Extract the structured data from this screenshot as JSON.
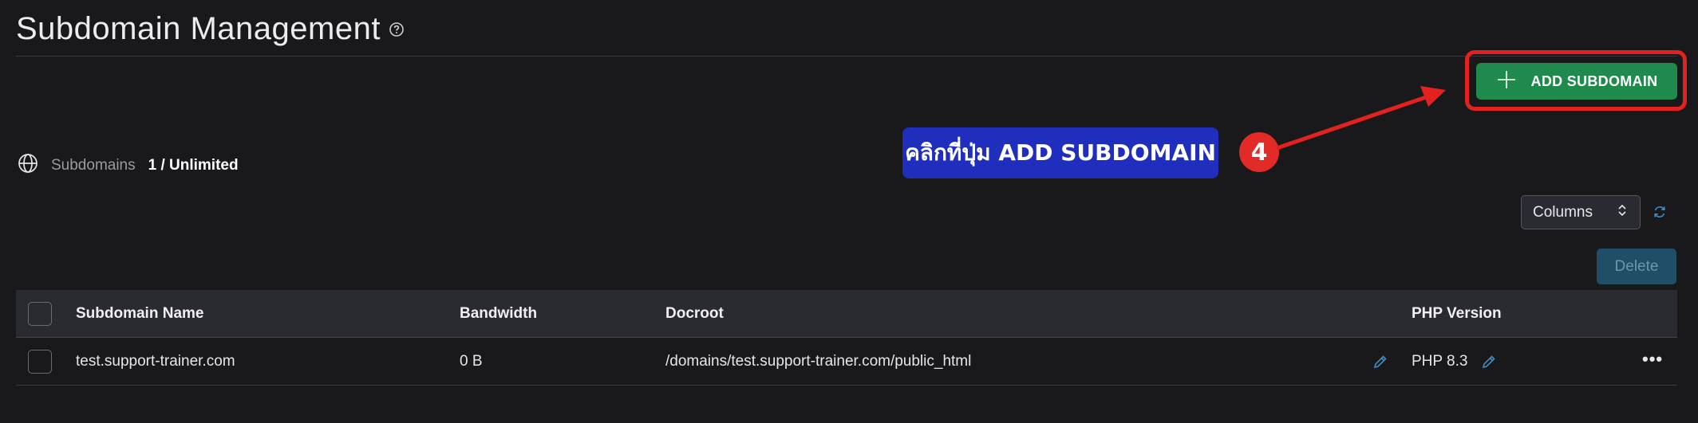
{
  "header": {
    "title": "Subdomain Management"
  },
  "toolbar": {
    "add_label": "ADD SUBDOMAIN",
    "columns_label": "Columns",
    "delete_label": "Delete"
  },
  "annotation": {
    "callout_text": "คลิกที่ปุ่ม ADD  SUBDOMAIN",
    "step_number": "4",
    "highlight_color": "#e3211e",
    "callout_color": "#1f2ebd"
  },
  "quota": {
    "label": "Subdomains",
    "value": "1 / Unlimited"
  },
  "table": {
    "columns": [
      "Subdomain Name",
      "Bandwidth",
      "Docroot",
      "PHP Version"
    ],
    "rows": [
      {
        "name": "test.support-trainer.com",
        "bandwidth": "0 B",
        "docroot": "/domains/test.support-trainer.com/public_html",
        "php": "PHP 8.3"
      }
    ]
  },
  "colors": {
    "accent_green": "#1f8a4c",
    "delete_blue": "#1f4e66",
    "background": "#19191c"
  },
  "icons": [
    "help-circle-icon",
    "plus-icon",
    "globe-icon",
    "chevron-up-down-icon",
    "refresh-icon",
    "pencil-icon",
    "more-horizontal-icon"
  ]
}
